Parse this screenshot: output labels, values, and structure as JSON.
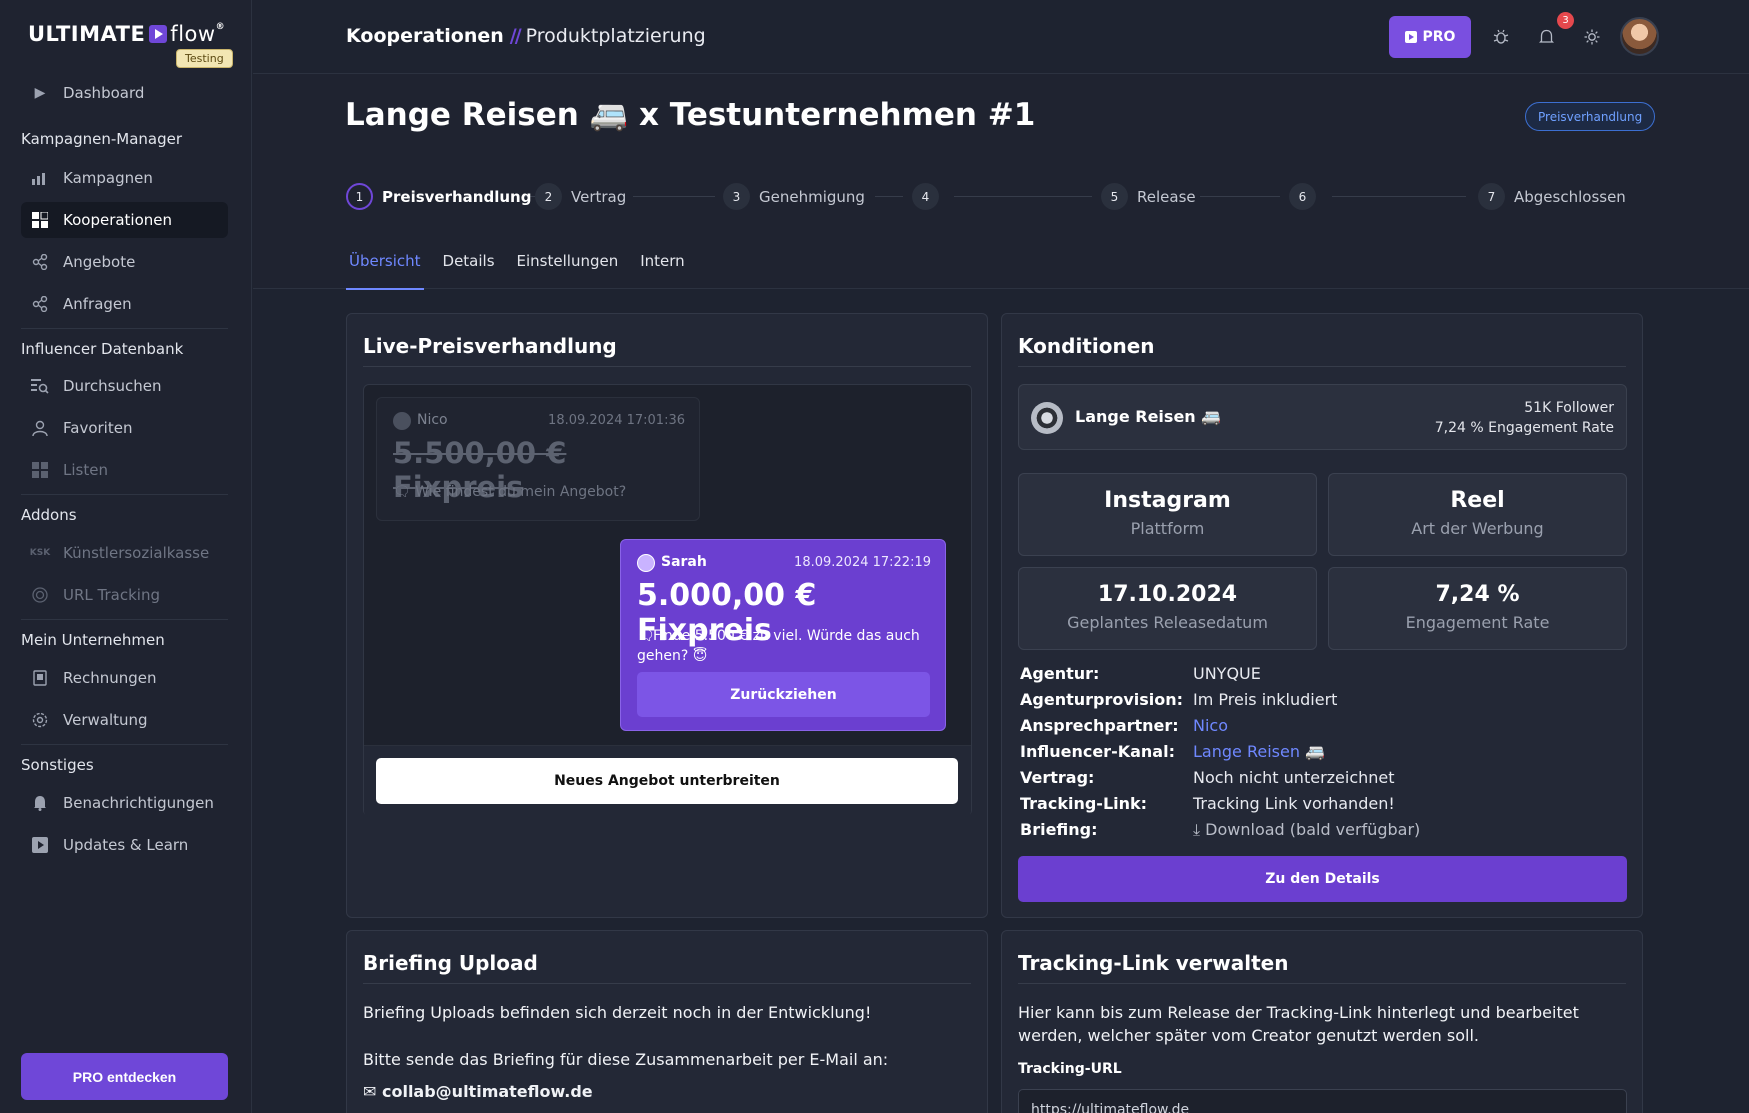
{
  "brand": {
    "name_bold": "ULTIMATE",
    "name_light": "flow",
    "reg": "®",
    "badge": "Testing"
  },
  "sidebar": {
    "dashboard": "Dashboard",
    "sections": {
      "kampagnen_manager": "Kampagnen-Manager",
      "influencer_datenbank": "Influencer Datenbank",
      "addons": "Addons",
      "mein_unternehmen": "Mein Unternehmen",
      "sonstiges": "Sonstiges"
    },
    "items": {
      "kampagnen": "Kampagnen",
      "kooperationen": "Kooperationen",
      "angebote": "Angebote",
      "anfragen": "Anfragen",
      "durchsuchen": "Durchsuchen",
      "favoriten": "Favoriten",
      "listen": "Listen",
      "ksk_icon": "KSK",
      "kuenstlersozialkasse": "Künstlersozialkasse",
      "url_tracking": "URL Tracking",
      "rechnungen": "Rechnungen",
      "verwaltung": "Verwaltung",
      "benachrichtigungen": "Benachrichtigungen",
      "updates": "Updates & Learn"
    },
    "pro_button": "PRO entdecken"
  },
  "topbar": {
    "breadcrumb_1": "Kooperationen",
    "breadcrumb_sep": "//",
    "breadcrumb_2": "Produktplatzierung",
    "pro_label": "PRO",
    "notification_count": "3"
  },
  "header": {
    "title": "Lange Reisen 🚐 x Testunternehmen #1",
    "status": "Preisverhandlung",
    "steps": [
      {
        "num": "1",
        "label": "Preisverhandlung"
      },
      {
        "num": "2",
        "label": "Vertrag"
      },
      {
        "num": "3",
        "label": "Genehmigung"
      },
      {
        "num": "4",
        "label": ""
      },
      {
        "num": "5",
        "label": "Release"
      },
      {
        "num": "6",
        "label": ""
      },
      {
        "num": "7",
        "label": "Abgeschlossen"
      }
    ],
    "tabs": [
      "Übersicht",
      "Details",
      "Einstellungen",
      "Intern"
    ]
  },
  "negotiation": {
    "title": "Live-Preisverhandlung",
    "old_offer": {
      "name": "Nico",
      "date": "18.09.2024 17:01:36",
      "price": "5.500,00 € Fixpreis",
      "message": "Wie findest du mein Angebot?"
    },
    "new_offer": {
      "name": "Sarah",
      "date": "18.09.2024 17:22:19",
      "price": "5.000,00 € Fixpreis",
      "message": "Finde 5.500 € zu viel. Würde das auch gehen? 😇",
      "button": "Zurückziehen"
    },
    "new_offer_button": "Neues Angebot unterbreiten"
  },
  "conditions": {
    "title": "Konditionen",
    "influencer": {
      "name": "Lange Reisen 🚐",
      "followers": "51K Follower",
      "engagement": "7,24 % Engagement Rate"
    },
    "tiles": [
      {
        "value": "Instagram",
        "label": "Plattform"
      },
      {
        "value": "Reel",
        "label": "Art der Werbung"
      },
      {
        "value": "17.10.2024",
        "label": "Geplantes Releasedatum"
      },
      {
        "value": "7,24 %",
        "label": "Engagement Rate"
      }
    ],
    "fields": [
      {
        "key": "Agentur:",
        "value": "UNYQUE"
      },
      {
        "key": "Agenturprovision:",
        "value": "Im Preis inkludiert"
      },
      {
        "key": "Ansprechpartner:",
        "value": "Nico"
      },
      {
        "key": "Influencer-Kanal:",
        "value": "Lange Reisen 🚐"
      },
      {
        "key": "Vertrag:",
        "value": "Noch nicht unterzeichnet"
      },
      {
        "key": "Tracking-Link:",
        "value": "Tracking Link vorhanden!"
      },
      {
        "key": "Briefing:",
        "value": "Download (bald verfügbar)"
      }
    ],
    "details_button": "Zu den Details"
  },
  "briefing": {
    "title": "Briefing Upload",
    "line1": "Briefing Uploads befinden sich derzeit noch in der Entwicklung!",
    "line2": "Bitte sende das Briefing für diese Zusammenarbeit per E-Mail an:",
    "email": "collab@ultimateflow.de"
  },
  "tracking": {
    "title": "Tracking-Link verwalten",
    "description": "Hier kann bis zum Release der Tracking-Link hinterlegt und bearbeitet werden, welcher später vom Creator genutzt werden soll.",
    "url_label": "Tracking-URL",
    "url_value": "https://ultimateflow.de"
  },
  "colors": {
    "accent": "#6f47d8",
    "link": "#6f88ff",
    "status": "#6fa0ff",
    "badge": "#e5484d"
  }
}
